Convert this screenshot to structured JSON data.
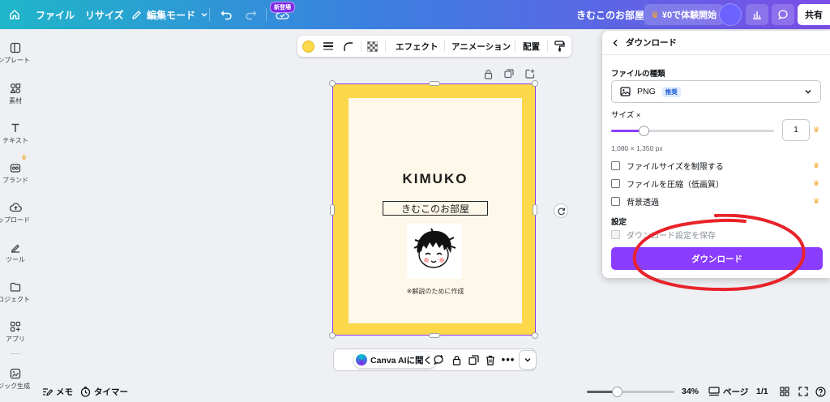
{
  "topbar": {
    "file_label": "ファイル",
    "resize_label": "リサイズ",
    "edit_mode_label": "編集モード",
    "new_badge": "新登場",
    "doc_title": "きむこのお部屋",
    "trial_label": "¥0で体験開始",
    "share_label": "共有"
  },
  "sidebar": {
    "items": [
      {
        "label": "テンプレート",
        "icon": "template-icon"
      },
      {
        "label": "素材",
        "icon": "elements-icon"
      },
      {
        "label": "テキスト",
        "icon": "text-icon"
      },
      {
        "label": "ブランド",
        "icon": "brand-icon"
      },
      {
        "label": "アップロード",
        "icon": "upload-icon"
      },
      {
        "label": "ツール",
        "icon": "tools-icon"
      },
      {
        "label": "プロジェクト",
        "icon": "projects-icon"
      },
      {
        "label": "アプリ",
        "icon": "apps-icon"
      },
      {
        "label": "マジック生成",
        "icon": "magic-icon"
      }
    ]
  },
  "floatbar": {
    "color": "#fcd84a",
    "effects_label": "エフェクト",
    "animation_label": "アニメーション",
    "position_label": "配置"
  },
  "canvas": {
    "title": "KIMUKO",
    "subtitle": "きむこのお部屋",
    "note": "※解説のために作成",
    "bg_color": "#fcd84a",
    "inner_color": "#fef8ea"
  },
  "bottom_bar": {
    "ai_label": "Canva AIに聞く"
  },
  "status": {
    "memo_label": "メモ",
    "timer_label": "タイマー",
    "zoom": "34%",
    "zoom_fraction": 0.34,
    "pages_label": "ページ",
    "page_count": "1/1"
  },
  "download_panel": {
    "title": "ダウンロード",
    "file_type_label": "ファイルの種類",
    "file_type_value": "PNG",
    "recommended_badge": "推奨",
    "size_label": "サイズ ×",
    "size_value": "1",
    "size_fraction": 0.2,
    "dimensions": "1,080 × 1,350 px",
    "options": [
      {
        "label": "ファイルサイズを制限する",
        "checked": false,
        "premium": true
      },
      {
        "label": "ファイルを圧縮（低画質）",
        "checked": false,
        "premium": true
      },
      {
        "label": "背景透過",
        "checked": false,
        "premium": true
      }
    ],
    "settings_label": "設定",
    "save_settings_label": "ダウンロード設定を保存",
    "download_button": "ダウンロード"
  }
}
